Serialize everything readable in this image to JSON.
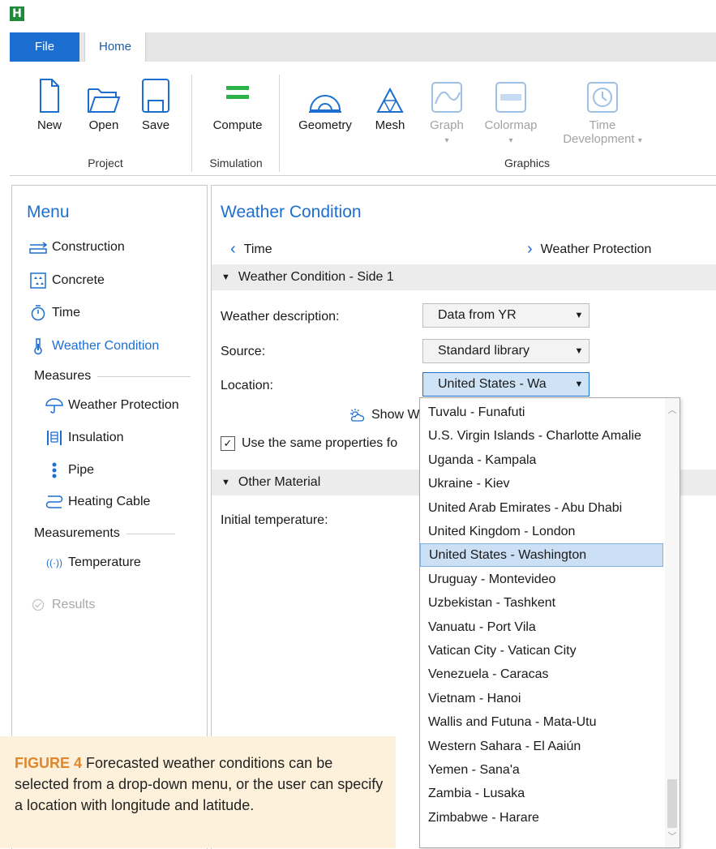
{
  "app": {
    "logo_letter": "H"
  },
  "ribbon": {
    "tabs": [
      {
        "label": "File"
      },
      {
        "label": "Home"
      }
    ],
    "buttons": {
      "new": "New",
      "open": "Open",
      "save": "Save",
      "compute": "Compute",
      "geometry": "Geometry",
      "mesh": "Mesh",
      "graph": "Graph",
      "colormap": "Colormap",
      "time_dev_line1": "Time",
      "time_dev_line2": "Development"
    },
    "groups": {
      "project": "Project",
      "simulation": "Simulation",
      "graphics": "Graphics"
    }
  },
  "menu": {
    "title": "Menu",
    "items": {
      "construction": "Construction",
      "concrete": "Concrete",
      "time": "Time",
      "weather_condition": "Weather Condition",
      "measures_header": "Measures",
      "weather_protection": "Weather Protection",
      "insulation": "Insulation",
      "pipe": "Pipe",
      "heating_cable": "Heating Cable",
      "measurements_header": "Measurements",
      "temperature": "Temperature",
      "results": "Results"
    }
  },
  "main": {
    "title": "Weather Condition",
    "nav_prev": "Time",
    "nav_next": "Weather Protection",
    "section1": "Weather Condition - Side 1",
    "weather_description_label": "Weather description:",
    "weather_description_value": "Data from YR",
    "source_label": "Source:",
    "source_value": "Standard library",
    "location_label": "Location:",
    "location_value": "United States - Wa",
    "show_weather": "Show W",
    "same_properties": "Use the same properties fo",
    "section2": "Other Material",
    "initial_temperature_label": "Initial temperature:"
  },
  "dropdown": {
    "selected_index": 6,
    "items": [
      "Tuvalu - Funafuti",
      "U.S. Virgin Islands - Charlotte Amalie",
      "Uganda - Kampala",
      "Ukraine - Kiev",
      "United Arab Emirates - Abu Dhabi",
      "United Kingdom - London",
      "United States - Washington",
      "Uruguay - Montevideo",
      "Uzbekistan - Tashkent",
      "Vanuatu - Port Vila",
      "Vatican City - Vatican City",
      "Venezuela - Caracas",
      "Vietnam - Hanoi",
      "Wallis and Futuna - Mata-Utu",
      "Western Sahara - El Aaiún",
      "Yemen - Sana'a",
      "Zambia - Lusaka",
      "Zimbabwe - Harare"
    ]
  },
  "caption": {
    "figure_label": "FIGURE 4",
    "text": "Forecasted weather conditions can be selected from a drop-down menu, or the user can specify a location with longitude and latitude."
  },
  "colors": {
    "accent": "#1c6fd1",
    "compute_green": "#2bb34a",
    "caption_bg": "#fdf1dc",
    "figure_orange": "#e0862c"
  }
}
